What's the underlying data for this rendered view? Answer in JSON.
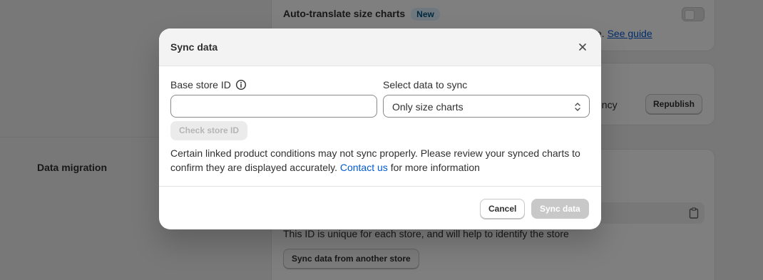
{
  "background": {
    "auto_translate": {
      "title": "Auto-translate size charts",
      "badge": "New",
      "description_tail": "e.",
      "guide_link": "See guide"
    },
    "republish_card": {
      "text_tail": "ency",
      "republish_label": "Republish"
    },
    "data_migration": {
      "section_title": "Data migration",
      "id_note": "This ID is unique for each store, and will help to identify the store",
      "sync_other_label": "Sync data from another store"
    }
  },
  "modal": {
    "title": "Sync data",
    "base_store_label": "Base store ID",
    "base_store_value": "",
    "select_label": "Select data to sync",
    "select_value": "Only size charts",
    "check_button": "Check store ID",
    "notice_text": "Certain linked product conditions may not sync properly. Please review your synced charts to confirm they are displayed accurately.",
    "contact_link": "Contact us",
    "notice_tail": "for more information",
    "cancel_label": "Cancel",
    "sync_label": "Sync data"
  },
  "colors": {
    "link": "#005bd3",
    "badge_bg": "#e0f0ff",
    "disabled_button": "#c8c8c8"
  },
  "icons": [
    "info-icon",
    "close-icon",
    "select-chevrons-icon",
    "clipboard-icon"
  ]
}
